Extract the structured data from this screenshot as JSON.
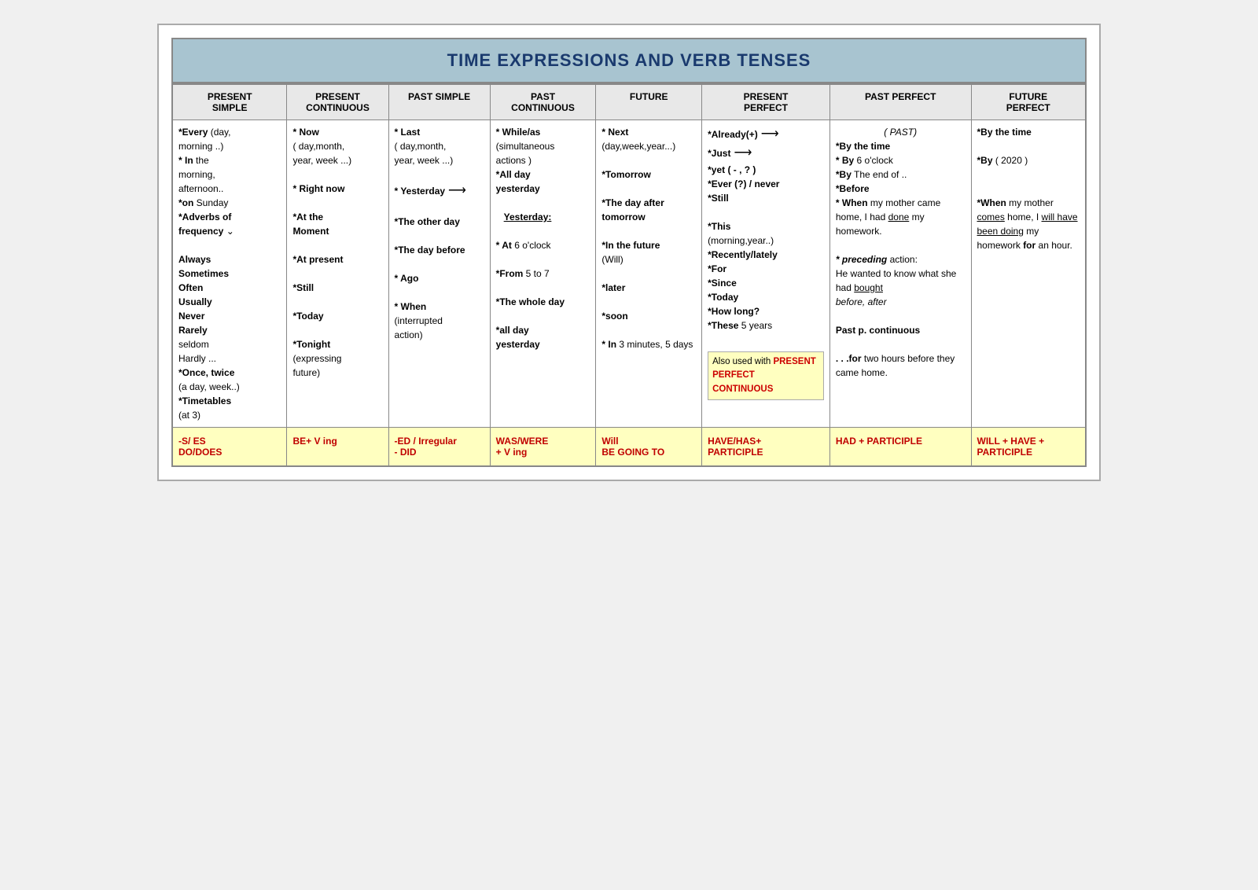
{
  "title": "TIME EXPRESSIONS AND VERB TENSES",
  "columns": [
    {
      "id": "present-simple",
      "line1": "PRESENT",
      "line2": "SIMPLE"
    },
    {
      "id": "present-continuous",
      "line1": "PRESENT",
      "line2": "CONTINUOUS"
    },
    {
      "id": "past-simple",
      "line1": "PAST SIMPLE",
      "line2": ""
    },
    {
      "id": "past-continuous",
      "line1": "PAST",
      "line2": "CONTINUOUS"
    },
    {
      "id": "future",
      "line1": "FUTURE",
      "line2": ""
    },
    {
      "id": "present-perfect",
      "line1": "PRESENT",
      "line2": "PERFECT"
    },
    {
      "id": "past-perfect",
      "line1": "PAST PERFECT",
      "line2": ""
    },
    {
      "id": "future-perfect",
      "line1": "FUTURE",
      "line2": "PERFECT"
    }
  ],
  "footer": [
    "-S/ ES\nDO/DOES",
    "BE+ V ing",
    "-ED / Irregular\n- DID",
    "WAS/WERE\n+ V ing",
    "Will\nBE GOING TO",
    "HAVE/HAS+\nPARTICIPLE",
    "HAD + PARTICIPLE",
    "WILL + HAVE +\nPARTICIPLE"
  ]
}
